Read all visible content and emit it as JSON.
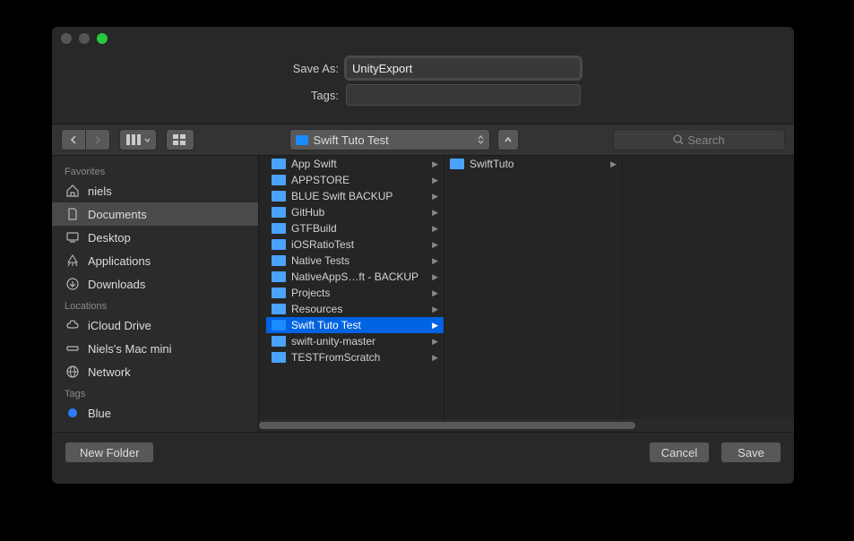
{
  "form": {
    "save_as_label": "Save As:",
    "save_as_value": "UnityExport",
    "tags_label": "Tags:",
    "tags_value": ""
  },
  "toolbar": {
    "path_label": "Swift Tuto Test",
    "search_placeholder": "Search"
  },
  "sidebar": {
    "favorites_label": "Favorites",
    "locations_label": "Locations",
    "tags_label": "Tags",
    "favorites": [
      {
        "label": "niels",
        "icon": "home"
      },
      {
        "label": "Documents",
        "icon": "doc",
        "selected": true
      },
      {
        "label": "Desktop",
        "icon": "desktop"
      },
      {
        "label": "Applications",
        "icon": "app"
      },
      {
        "label": "Downloads",
        "icon": "down"
      }
    ],
    "locations": [
      {
        "label": "iCloud Drive",
        "icon": "cloud"
      },
      {
        "label": "Niels's Mac mini",
        "icon": "mini"
      },
      {
        "label": "Network",
        "icon": "globe"
      }
    ],
    "tags": [
      {
        "label": "Blue",
        "color": "#2e7bff"
      }
    ]
  },
  "column1": [
    {
      "label": "App Swift"
    },
    {
      "label": "APPSTORE"
    },
    {
      "label": "BLUE Swift BACKUP"
    },
    {
      "label": "GitHub"
    },
    {
      "label": "GTFBuild"
    },
    {
      "label": "iOSRatioTest"
    },
    {
      "label": "Native Tests"
    },
    {
      "label": "NativeAppS…ft - BACKUP"
    },
    {
      "label": "Projects"
    },
    {
      "label": "Resources"
    },
    {
      "label": "Swift Tuto Test",
      "selected": true
    },
    {
      "label": "swift-unity-master"
    },
    {
      "label": "TESTFromScratch"
    }
  ],
  "column2": [
    {
      "label": "SwiftTuto"
    }
  ],
  "footer": {
    "new_folder": "New Folder",
    "cancel": "Cancel",
    "save": "Save"
  }
}
